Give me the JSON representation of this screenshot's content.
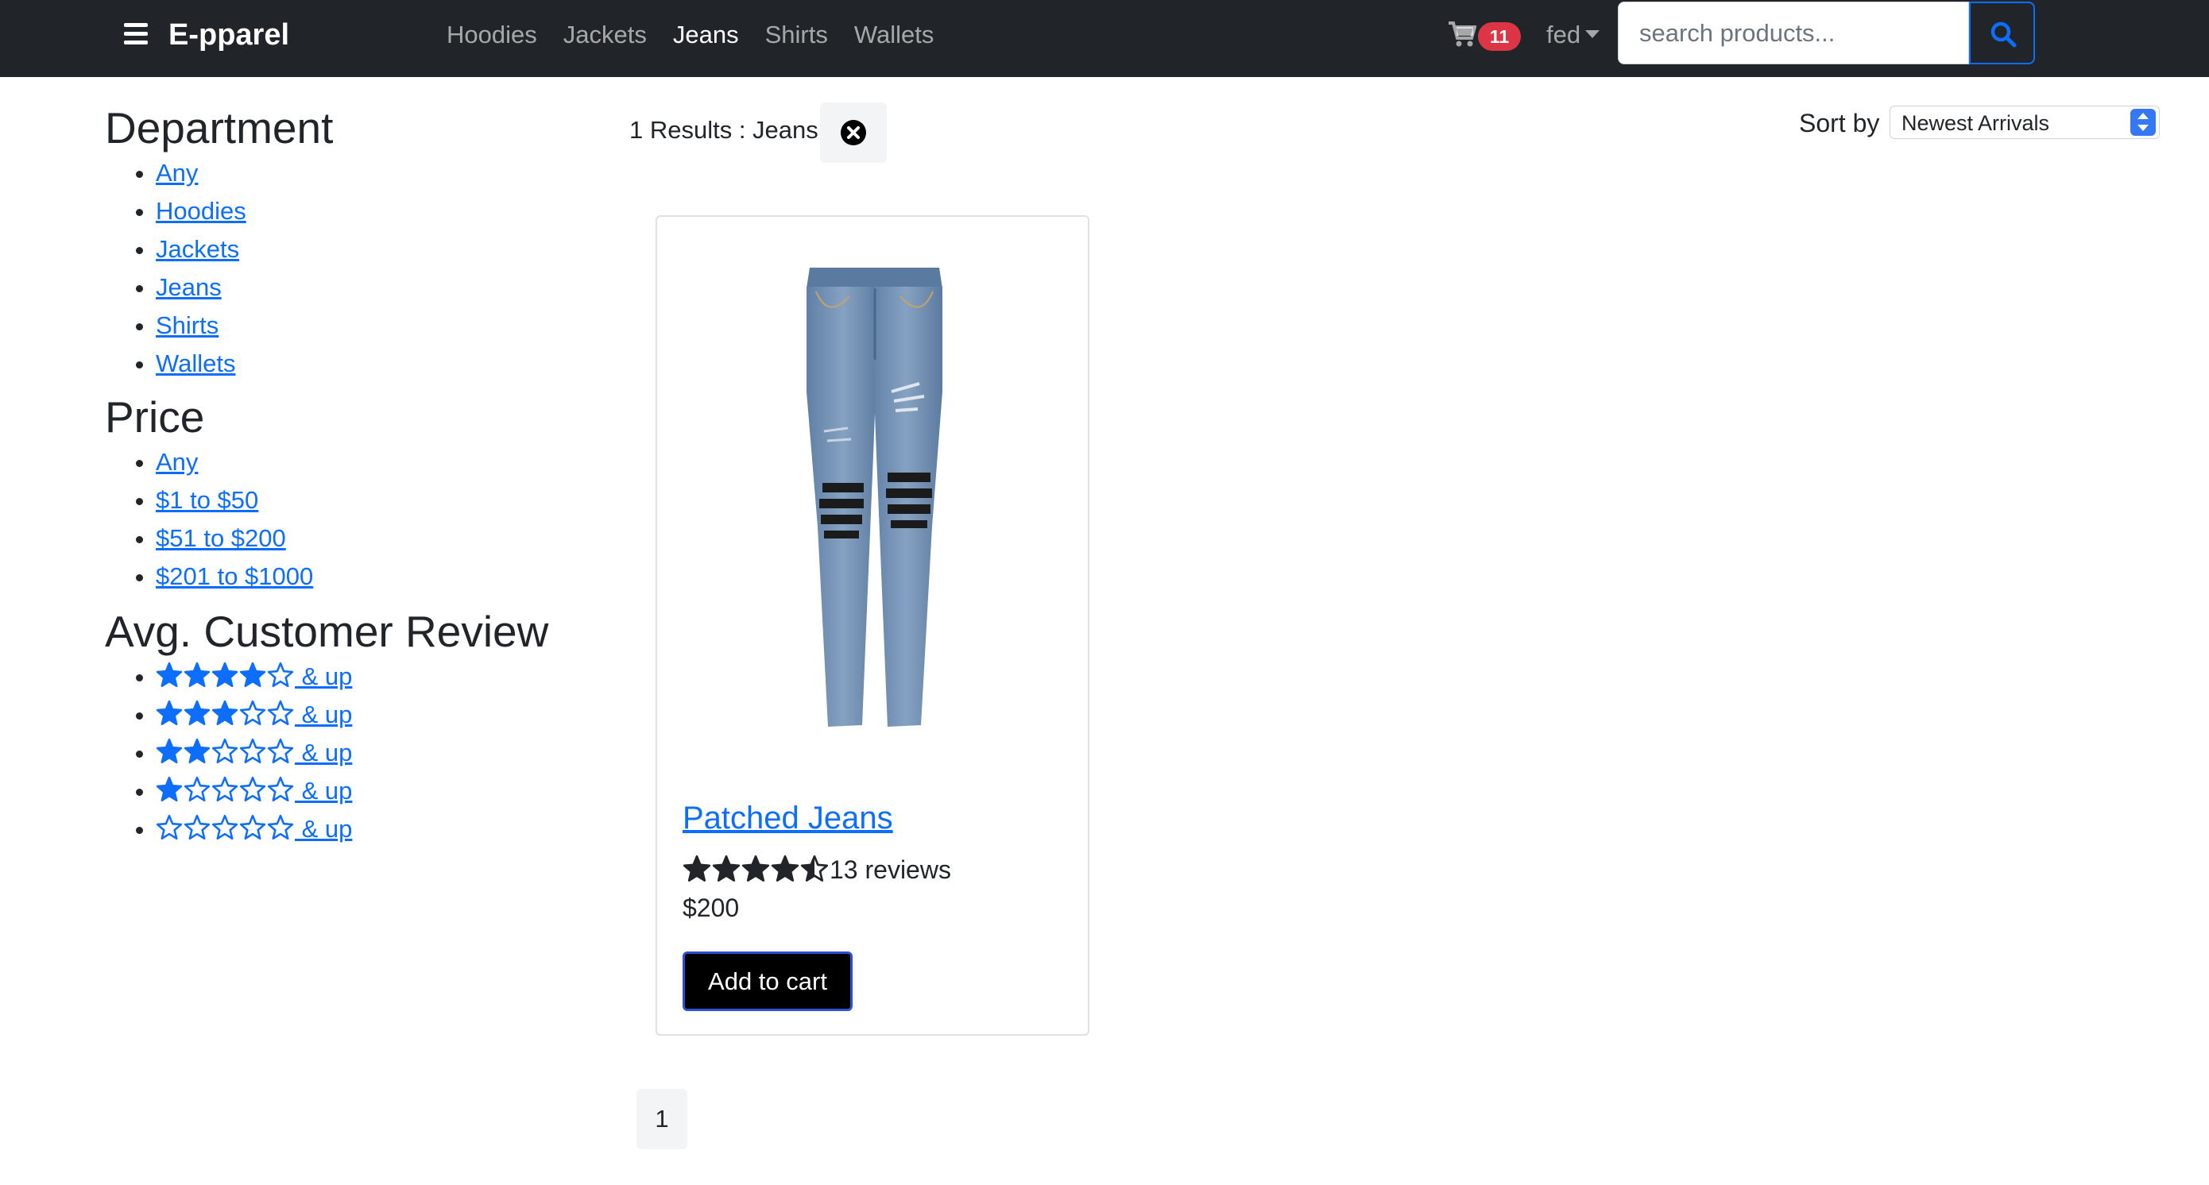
{
  "brand": "E-pparel",
  "nav": {
    "links": [
      {
        "label": "Hoodies",
        "active": false
      },
      {
        "label": "Jackets",
        "active": false
      },
      {
        "label": "Jeans",
        "active": true
      },
      {
        "label": "Shirts",
        "active": false
      },
      {
        "label": "Wallets",
        "active": false
      }
    ],
    "cart_count": "11",
    "user_name": "fed",
    "search": {
      "placeholder": "search products...",
      "value": ""
    }
  },
  "sidebar": {
    "department": {
      "heading": "Department",
      "items": [
        "Any",
        "Hoodies",
        "Jackets",
        "Jeans",
        "Shirts",
        "Wallets"
      ]
    },
    "price": {
      "heading": "Price",
      "items": [
        "Any",
        "$1 to $50",
        "$51 to $200",
        "$201 to $1000"
      ]
    },
    "review": {
      "heading": "Avg. Customer Review",
      "suffix": " & up",
      "filters": [
        {
          "stars_filled": 4,
          "stars_total": 5
        },
        {
          "stars_filled": 3,
          "stars_total": 5
        },
        {
          "stars_filled": 2,
          "stars_total": 5
        },
        {
          "stars_filled": 1,
          "stars_total": 5
        },
        {
          "stars_filled": 0,
          "stars_total": 5
        }
      ]
    }
  },
  "results": {
    "summary": "1 Results : Jeans",
    "sort_label": "Sort by",
    "sort_selected": "Newest Arrivals"
  },
  "product": {
    "name": "Patched Jeans",
    "rating": 4.5,
    "reviews_text": "13 reviews",
    "price": "$200",
    "add_to_cart_label": "Add to cart"
  },
  "pagination": {
    "current_page": "1"
  },
  "colors": {
    "navbar": "#212529",
    "link": "#0d6efd",
    "badge": "#dc3545",
    "star_dark": "#212529"
  },
  "icons": [
    "hamburger-icon",
    "cart-icon",
    "caret-down-icon",
    "search-icon",
    "clear-filter-icon",
    "star-icon"
  ]
}
